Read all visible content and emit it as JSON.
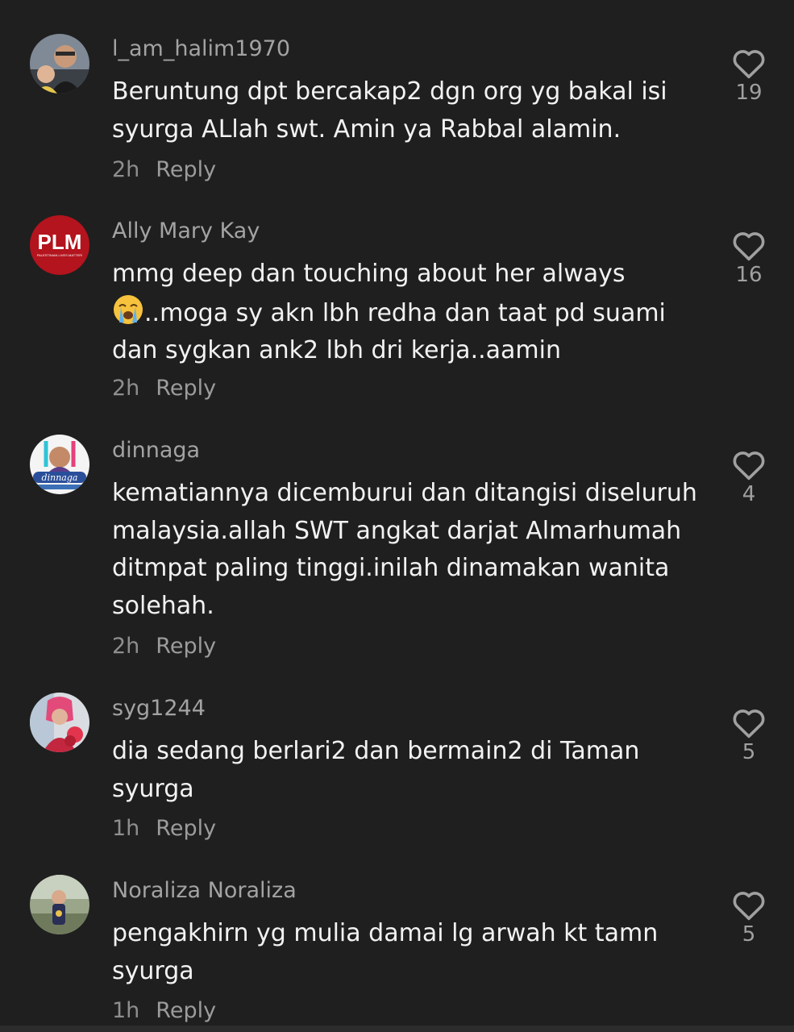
{
  "comments": [
    {
      "username": "l_am_halim1970",
      "text": "Beruntung dpt bercakap2 dgn org yg bakal isi\nsyurga ALlah swt. Amin ya Rabbal alamin.",
      "time": "2h",
      "reply_label": "Reply",
      "likes": "19",
      "avatar_icon": "user-photo"
    },
    {
      "username": "Ally Mary Kay",
      "text_before": "mmg deep dan touching about her always\n",
      "emoji_icon": "loudly-crying-face-icon",
      "text_after": "..moga sy akn lbh redha dan taat pd suami\ndan sygkan ank2 lbh dri kerja..aamin",
      "time": "2h",
      "reply_label": "Reply",
      "likes": "16",
      "avatar_text": "PLM",
      "avatar_subtext": "PALESTINIAN LIVES MATTER!",
      "avatar_color": "#b3141d"
    },
    {
      "username": "dinnaga",
      "text": "kematiannya dicemburui dan ditangisi diseluruh\nmalaysia.allah SWT angkat darjat Almarhumah\nditmpat paling tinggi.inilah dinamakan wanita\nsolehah.",
      "time": "2h",
      "reply_label": "Reply",
      "likes": "4",
      "avatar_script": "dinnaga"
    },
    {
      "username": "syg1244",
      "text": "dia sedang berlari2 dan bermain2 di Taman\nsyurga",
      "time": "1h",
      "reply_label": "Reply",
      "likes": "5",
      "avatar_icon": "user-photo"
    },
    {
      "username": "Noraliza Noraliza",
      "text": "pengakhirn yg mulia damai lg arwah kt tamn\nsyurga",
      "time": "1h",
      "reply_label": "Reply",
      "likes": "5",
      "avatar_icon": "user-photo"
    }
  ],
  "colors": {
    "background": "#1f1f1f",
    "username": "#a3a3a3",
    "comment_text": "#f2f2f2",
    "meta": "#8e8e8e"
  }
}
